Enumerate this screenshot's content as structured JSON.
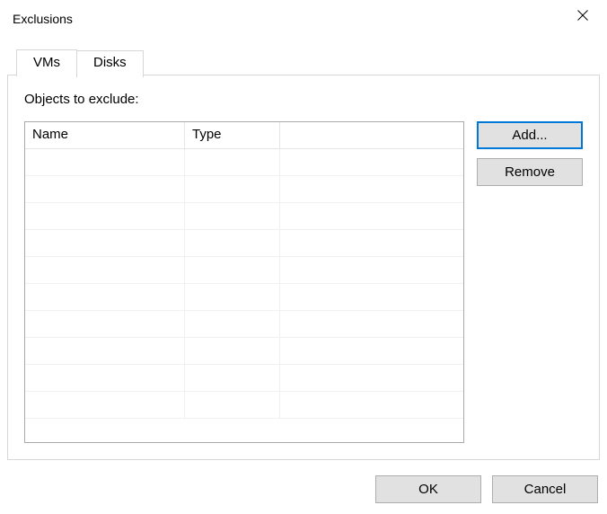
{
  "window": {
    "title": "Exclusions"
  },
  "tabs": {
    "vms": "VMs",
    "disks": "Disks",
    "active": "vms"
  },
  "panel": {
    "section_label": "Objects to exclude:",
    "columns": {
      "name": "Name",
      "type": "Type"
    },
    "rows": []
  },
  "buttons": {
    "add": "Add...",
    "remove": "Remove",
    "ok": "OK",
    "cancel": "Cancel"
  }
}
